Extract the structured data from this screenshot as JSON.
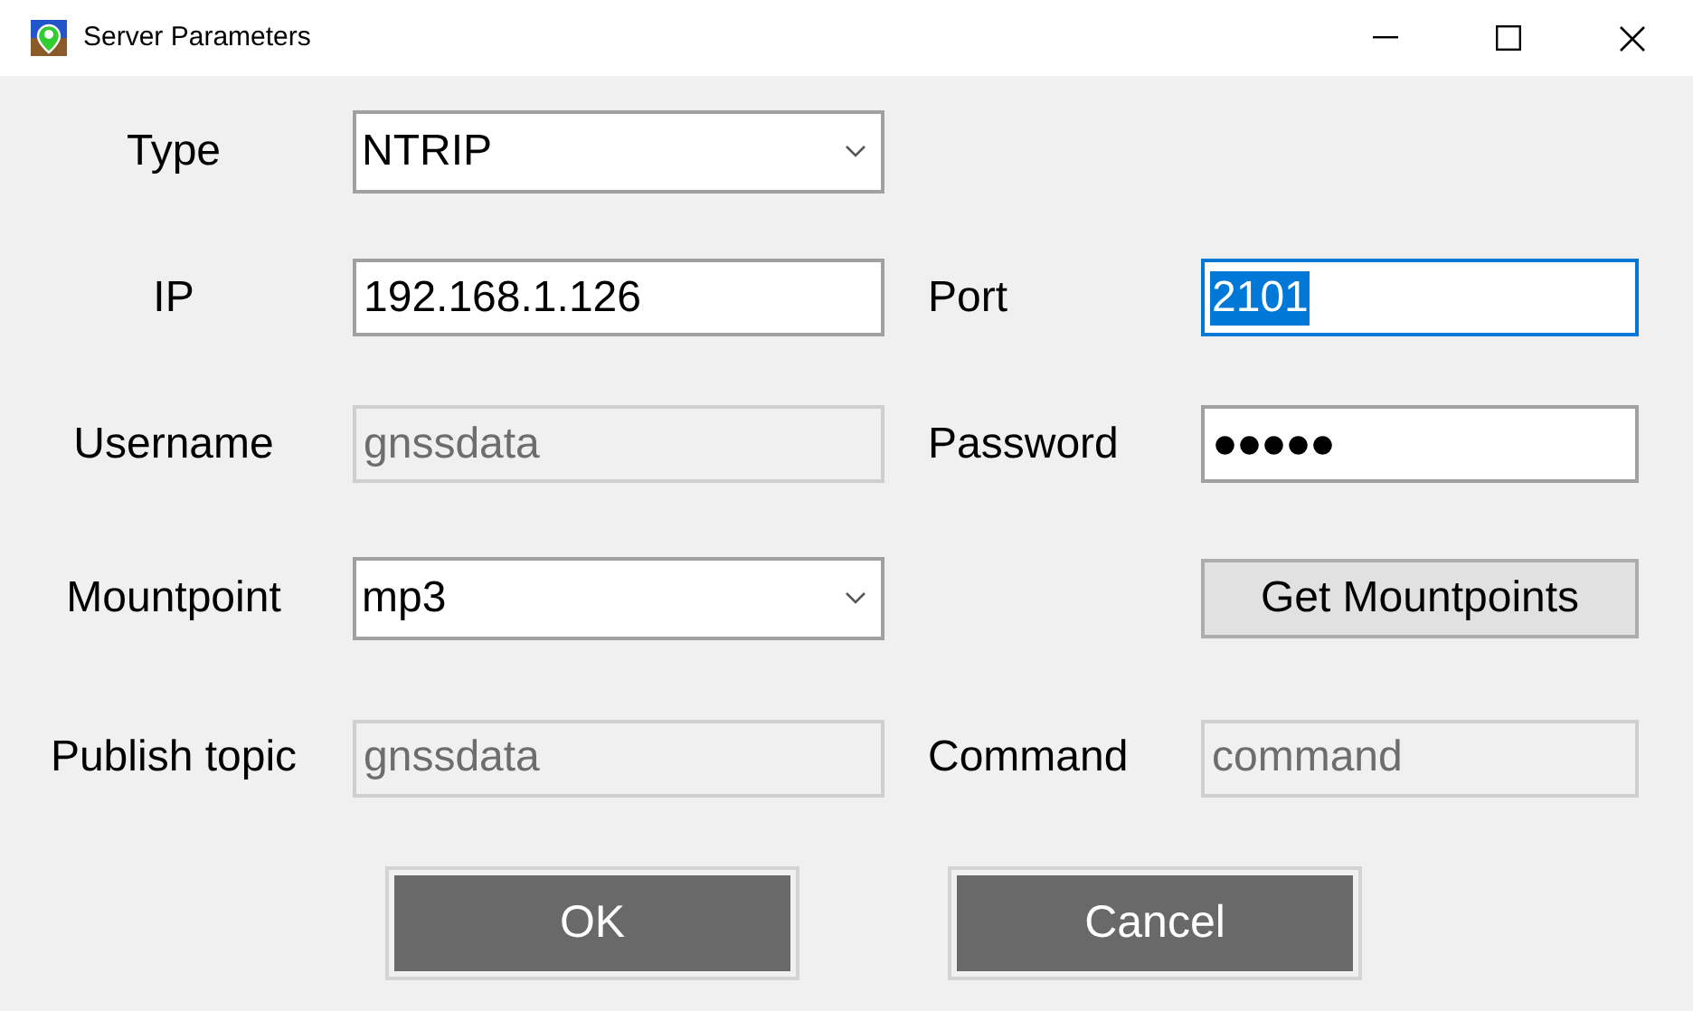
{
  "window": {
    "title": "Server Parameters"
  },
  "rows": [
    {
      "left": {
        "label": "Type",
        "kind": "combo",
        "value": "NTRIP"
      }
    },
    {
      "left": {
        "label": "IP",
        "kind": "text",
        "value": "192.168.1.126",
        "disabled": false
      },
      "right": {
        "label": "Port",
        "kind": "text",
        "value": "2101",
        "disabled": false,
        "selected": true
      }
    },
    {
      "left": {
        "label": "Username",
        "kind": "text",
        "value": "gnssdata",
        "disabled": true
      },
      "right": {
        "label": "Password",
        "kind": "password",
        "value": "●●●●●",
        "disabled": false,
        "selected": false
      }
    },
    {
      "left": {
        "label": "Mountpoint",
        "kind": "combo",
        "value": "mp3"
      },
      "right": {
        "label": "Get Mountpoints",
        "kind": "button"
      }
    },
    {
      "left": {
        "label": "Publish topic",
        "kind": "text",
        "value": "gnssdata",
        "disabled": true
      },
      "right": {
        "label": "Command",
        "kind": "text",
        "value": "command",
        "disabled": true,
        "selected": false
      }
    }
  ],
  "buttons": [
    "OK",
    "Cancel"
  ]
}
